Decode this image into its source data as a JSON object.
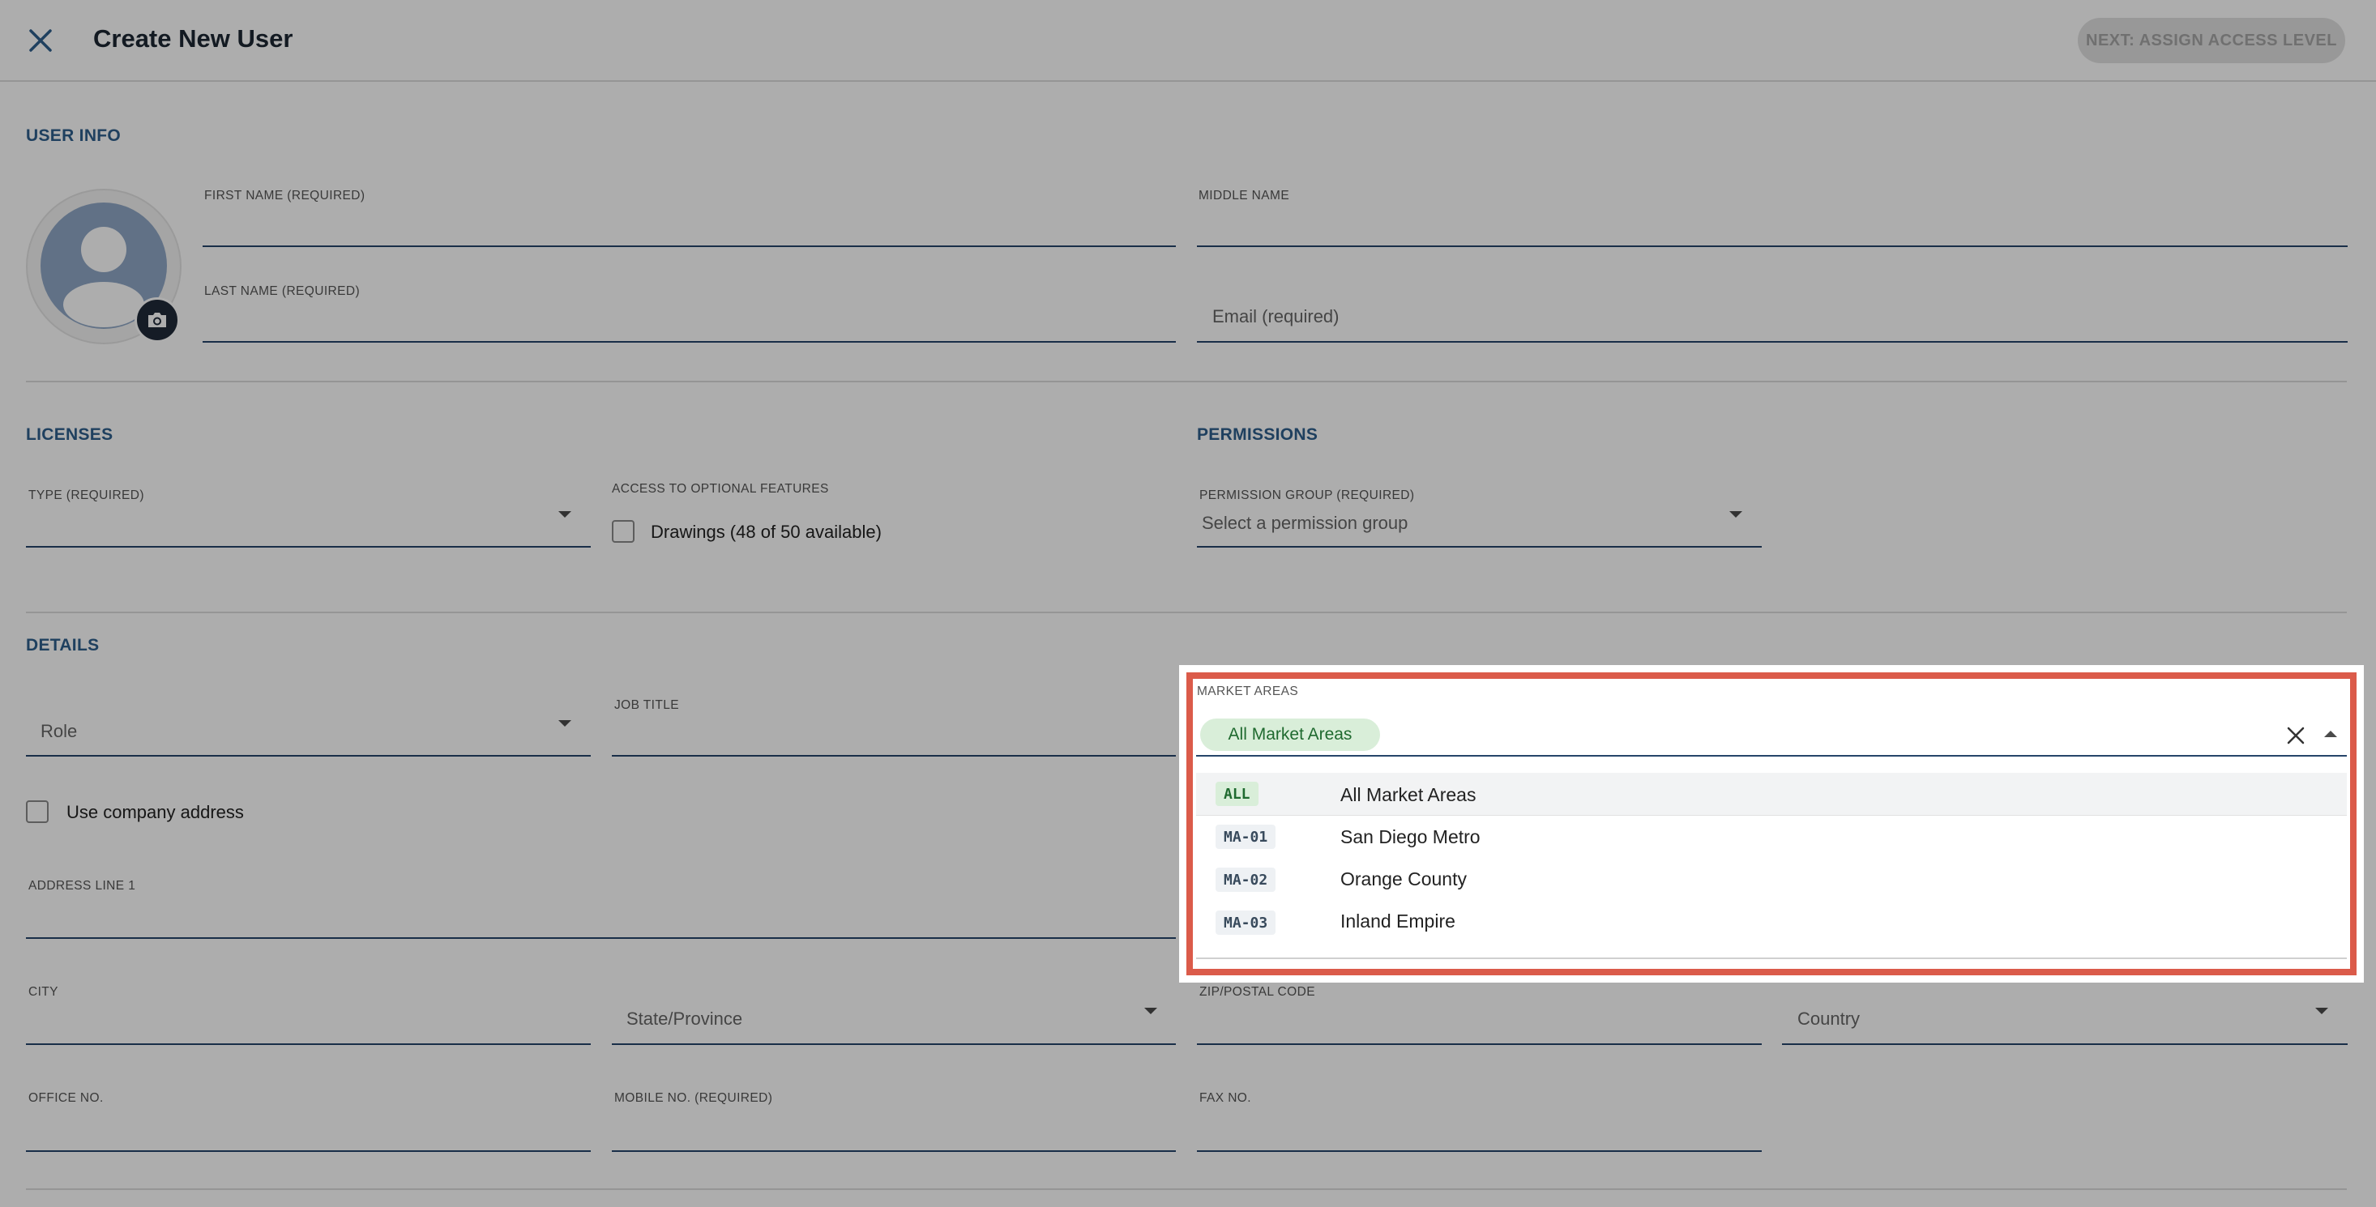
{
  "header": {
    "title": "Create New User",
    "next_button": "NEXT: ASSIGN ACCESS LEVEL"
  },
  "user_info": {
    "section": "USER INFO",
    "first_name_label": "FIRST NAME (REQUIRED)",
    "middle_name_label": "MIDDLE NAME",
    "last_name_label": "LAST NAME (REQUIRED)",
    "email_placeholder": "Email (required)"
  },
  "licenses": {
    "section": "LICENSES",
    "type_label": "TYPE (REQUIRED)",
    "optional_features_label": "ACCESS TO OPTIONAL FEATURES",
    "drawings_label": "Drawings (48 of 50 available)"
  },
  "permissions": {
    "section": "PERMISSIONS",
    "group_label": "PERMISSION GROUP (REQUIRED)",
    "group_placeholder": "Select a permission group"
  },
  "details": {
    "section": "DETAILS",
    "role_placeholder": "Role",
    "job_title_label": "JOB TITLE",
    "use_company_address": "Use company address",
    "address_line1_label": "ADDRESS LINE 1",
    "city_label": "CITY",
    "state_placeholder": "State/Province",
    "zip_label": "ZIP/POSTAL CODE",
    "country_placeholder": "Country",
    "office_label": "OFFICE NO.",
    "mobile_label": "MOBILE NO. (REQUIRED)",
    "fax_label": "FAX NO."
  },
  "market_areas": {
    "label": "MARKET AREAS",
    "selected_chip": "All Market Areas",
    "options": [
      {
        "code": "ALL",
        "name": "All Market Areas"
      },
      {
        "code": "MA-01",
        "name": "San Diego Metro"
      },
      {
        "code": "MA-02",
        "name": "Orange County"
      },
      {
        "code": "MA-03",
        "name": "Inland Empire"
      }
    ]
  },
  "colors": {
    "accent": "#2f5f8c",
    "highlight": "#db5b4a",
    "chip_bg": "#d9eed9",
    "chip_text": "#1f6a2f"
  },
  "icons": [
    "close-icon",
    "user-avatar-icon",
    "camera-icon",
    "dropdown-arrow-icon",
    "clear-icon"
  ]
}
